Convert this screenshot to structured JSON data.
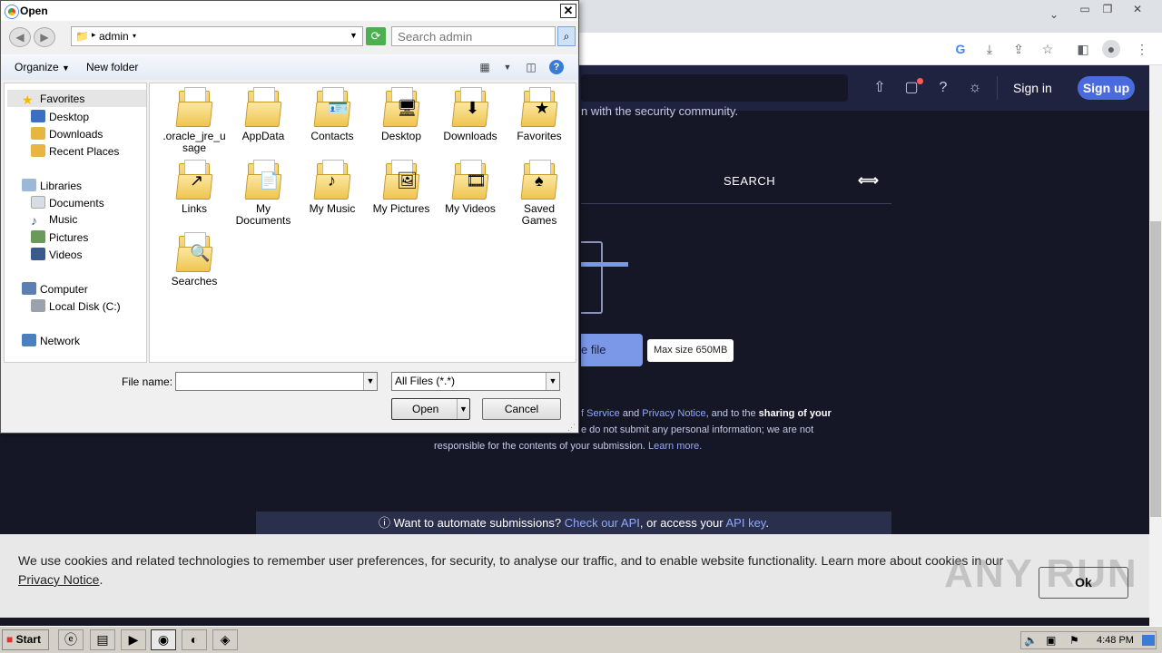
{
  "browser": {
    "icons": [
      "chevron-down-icon",
      "minimize-icon",
      "restore-icon",
      "close-icon",
      "google-icon",
      "download-icon",
      "share-icon",
      "star-icon",
      "sidebar-icon",
      "profile-icon",
      "menu-icon"
    ]
  },
  "site": {
    "nav": {
      "signin": "Sign in",
      "signup": "Sign up"
    },
    "tagline": "n with the security community.",
    "tab_search": "SEARCH",
    "choose_file": "e file",
    "max_size": "Max size 650MB",
    "terms": {
      "l1_a": "f Service",
      "l1_b": " and ",
      "l1_c": "Privacy Notice",
      "l1_d": ", and to the ",
      "l1_e": "sharing of your",
      "l2": "e do not submit any personal information; we are not",
      "l3_a": "responsible for the contents of your submission. ",
      "l3_b": "Learn more."
    },
    "api": {
      "a": "Want to automate submissions? ",
      "b": "Check our API",
      "c": ", or access your ",
      "d": "API key",
      "e": "."
    }
  },
  "cookie": {
    "text_a": "We use cookies and related technologies to remember user preferences, for security, to analyse our traffic, and to enable website functionality. Learn more about cookies in our ",
    "text_b": "Privacy Notice",
    "text_c": ".",
    "ok": "Ok",
    "watermark": "ANY RUN"
  },
  "dialog": {
    "title": "Open",
    "path": "admin",
    "search_placeholder": "Search admin",
    "organize": "Organize",
    "new_folder": "New folder",
    "nav": {
      "favorites": "Favorites",
      "desktop": "Desktop",
      "downloads": "Downloads",
      "recent": "Recent Places",
      "libraries": "Libraries",
      "documents": "Documents",
      "music": "Music",
      "pictures": "Pictures",
      "videos": "Videos",
      "computer": "Computer",
      "localdisk": "Local Disk (C:)",
      "network": "Network"
    },
    "items": [
      {
        "name": ".oracle_jre_u sage"
      },
      {
        "name": "AppData"
      },
      {
        "name": "Contacts"
      },
      {
        "name": "Desktop"
      },
      {
        "name": "Downloads"
      },
      {
        "name": "Favorites"
      },
      {
        "name": "Links"
      },
      {
        "name": "My Documents"
      },
      {
        "name": "My Music"
      },
      {
        "name": "My Pictures"
      },
      {
        "name": "My Videos"
      },
      {
        "name": "Saved Games"
      },
      {
        "name": "Searches"
      }
    ],
    "file_name_label": "File name:",
    "file_name_value": "",
    "file_type": "All Files (*.*)",
    "open": "Open",
    "cancel": "Cancel"
  },
  "taskbar": {
    "start": "Start",
    "clock": "4:48 PM"
  }
}
